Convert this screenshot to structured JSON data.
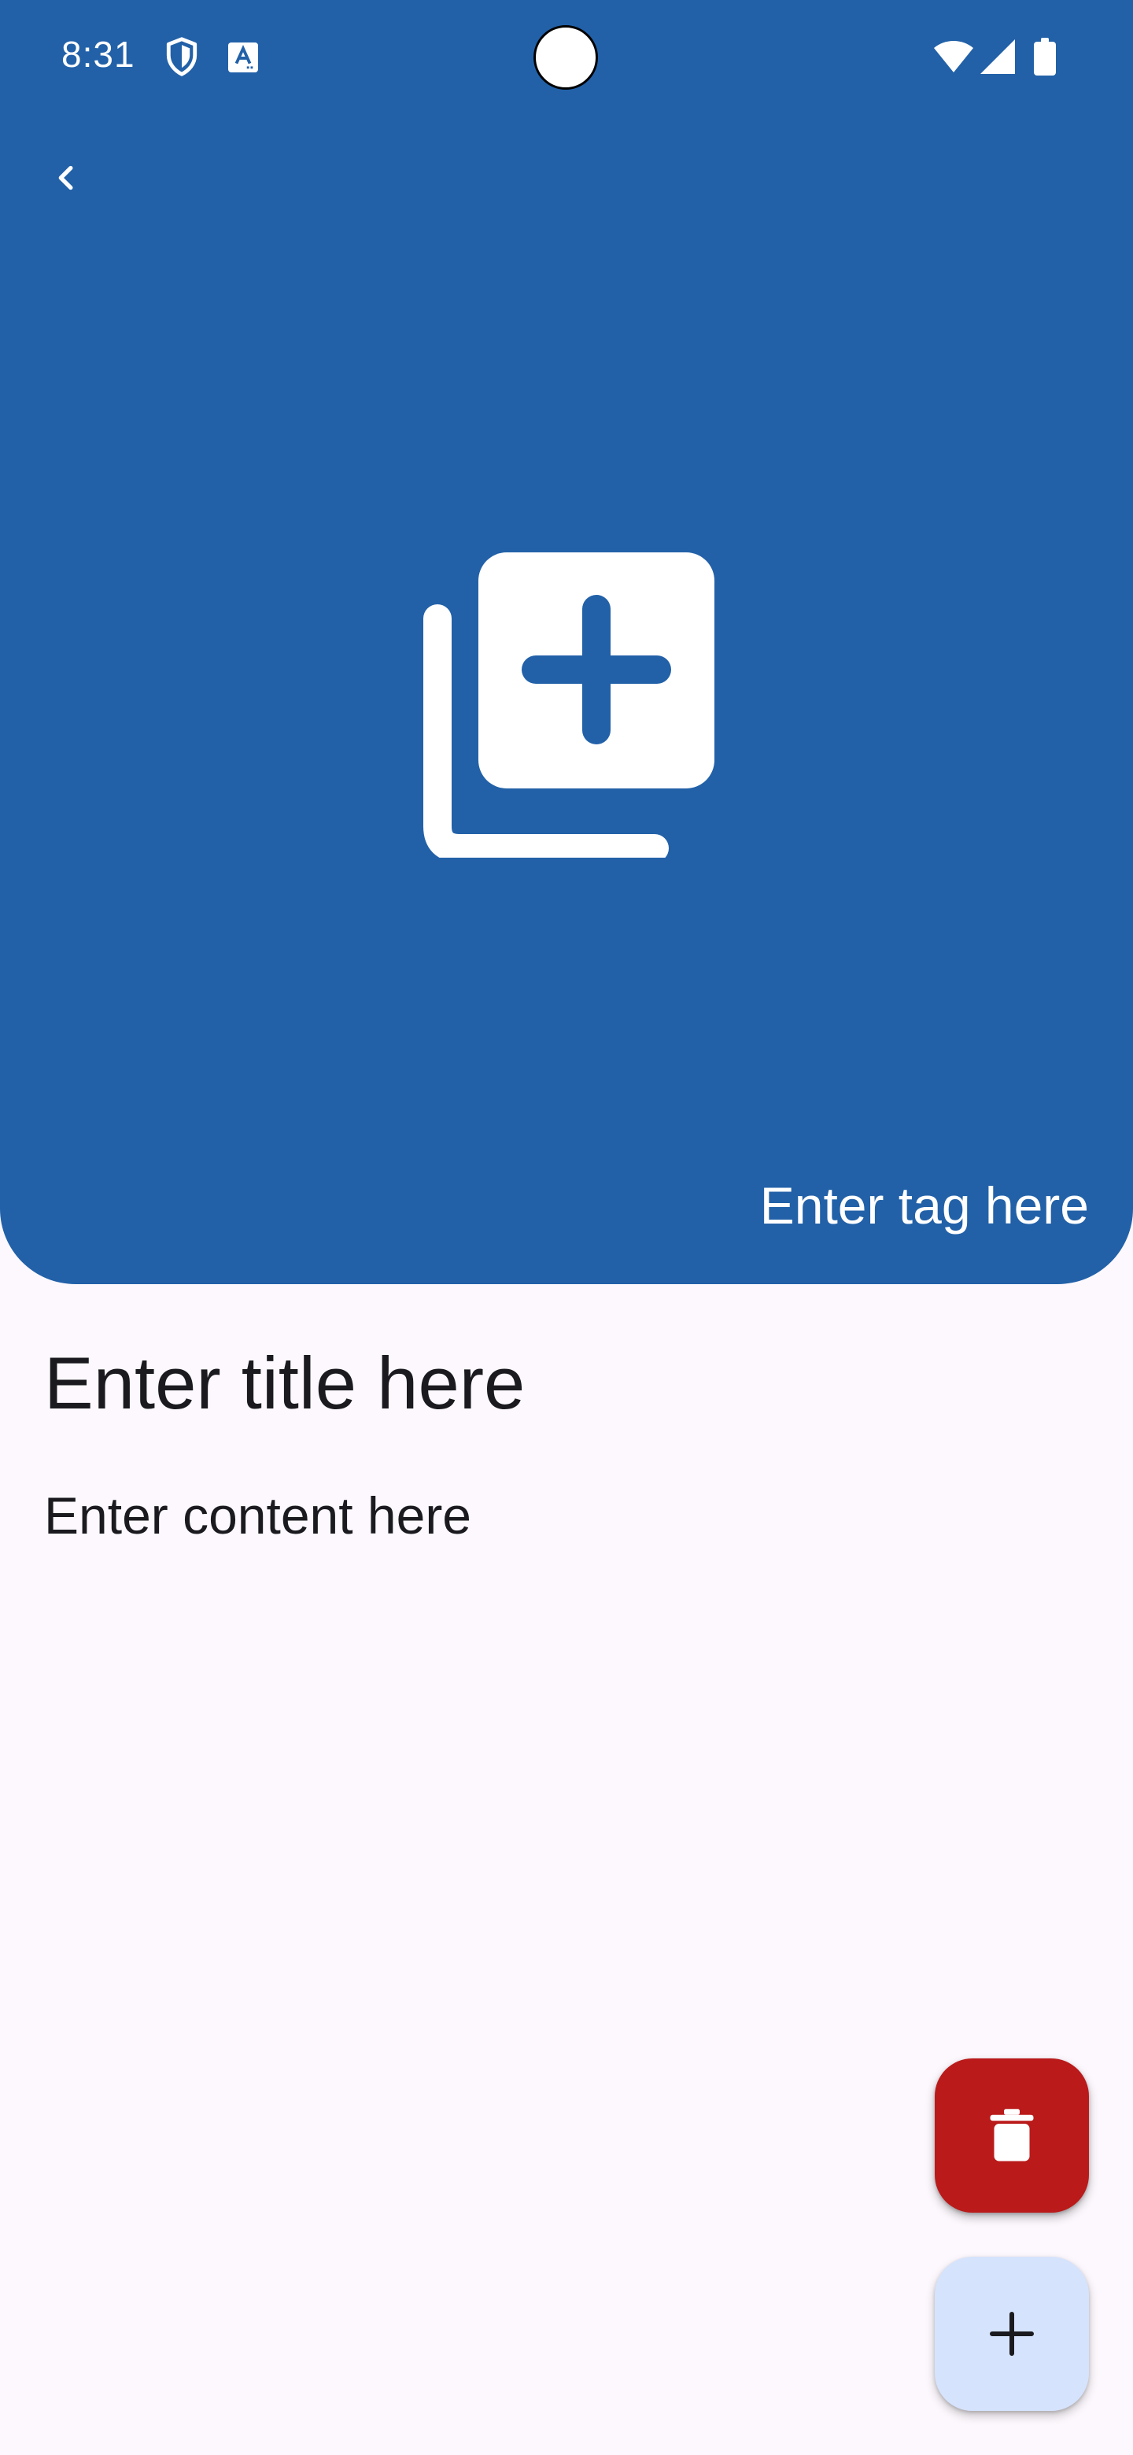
{
  "status_bar": {
    "time": "8:31",
    "icons": [
      "shield-icon",
      "text-a-icon",
      "wifi-icon",
      "cell-signal-icon",
      "battery-icon"
    ]
  },
  "header": {
    "background_color": "#2261A8",
    "back_icon": "chevron-left-icon",
    "add_image_icon": "add-to-photos-icon",
    "tag_placeholder": "Enter tag here"
  },
  "note": {
    "title_placeholder": "Enter title here",
    "content_placeholder": "Enter content here"
  },
  "fabs": {
    "delete_icon": "trash-icon",
    "delete_color": "#BA1A1A",
    "add_icon": "plus-icon",
    "add_color": "#D6E3FC"
  }
}
